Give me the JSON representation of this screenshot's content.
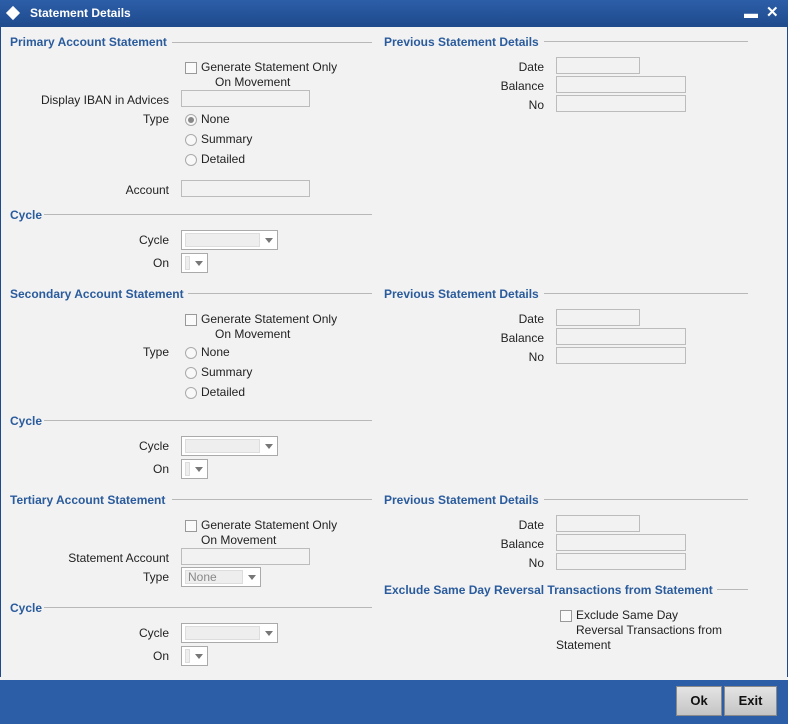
{
  "window": {
    "title": "Statement Details",
    "minimize": "▬",
    "close": "✕"
  },
  "primary": {
    "section": "Primary Account Statement",
    "gen_label_1": "Generate Statement Only",
    "gen_label_2": "On Movement",
    "iban_label": "Display IBAN in Advices",
    "type_label": "Type",
    "opt_none": "None",
    "opt_summary": "Summary",
    "opt_detailed": "Detailed",
    "selected_type": "None",
    "account_label": "Account",
    "cycle_section": "Cycle",
    "cycle_label": "Cycle",
    "on_label": "On"
  },
  "primary_prev": {
    "section": "Previous Statement Details",
    "date": "Date",
    "balance": "Balance",
    "no": "No"
  },
  "secondary": {
    "section": "Secondary Account Statement",
    "gen_label_1": "Generate Statement Only",
    "gen_label_2": "On Movement",
    "type_label": "Type",
    "opt_none": "None",
    "opt_summary": "Summary",
    "opt_detailed": "Detailed",
    "cycle_section": "Cycle",
    "cycle_label": "Cycle",
    "on_label": "On"
  },
  "secondary_prev": {
    "section": "Previous Statement Details",
    "date": "Date",
    "balance": "Balance",
    "no": "No"
  },
  "tertiary": {
    "section": "Tertiary Account Statement",
    "gen_label_1": "Generate Statement Only",
    "gen_label_2": "On Movement",
    "stmt_account_label": "Statement Account",
    "type_label": "Type",
    "type_value": "None",
    "cycle_section": "Cycle",
    "cycle_label": "Cycle",
    "on_label": "On"
  },
  "tertiary_prev": {
    "section": "Previous Statement Details",
    "date": "Date",
    "balance": "Balance",
    "no": "No"
  },
  "exclude": {
    "section": "Exclude Same Day Reversal Transactions from Statement",
    "line1": "Exclude Same Day",
    "line2": "Reversal Transactions from",
    "line3": "Statement"
  },
  "footer": {
    "ok": "Ok",
    "exit": "Exit"
  },
  "colors": {
    "titlebar": "#2c5ea8",
    "section_text": "#2a5b9c",
    "background": "#f2f2f2"
  }
}
